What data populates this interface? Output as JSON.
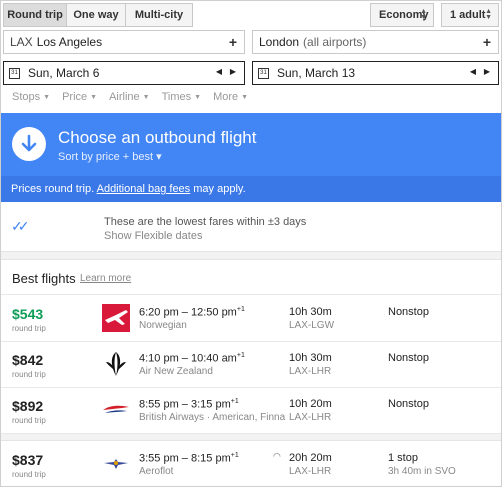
{
  "trip_types": [
    "Round trip",
    "One way",
    "Multi-city"
  ],
  "cabin": "Economy",
  "passengers": "1 adult",
  "origin": {
    "code": "LAX",
    "city": "Los Angeles"
  },
  "destination": {
    "city": "London",
    "detail": "(all airports)"
  },
  "depart_date": "Sun, March 6",
  "return_date": "Sun, March 13",
  "filters": [
    "Stops",
    "Price",
    "Airline",
    "Times",
    "More"
  ],
  "banner": {
    "title": "Choose an outbound flight",
    "sort": "Sort by price + best ▾"
  },
  "price_note": {
    "prefix": "Prices round trip.",
    "link": "Additional bag fees",
    "suffix": "may apply."
  },
  "lowest": {
    "text": "These are the lowest fares within ±3 days",
    "link": "Show Flexible dates"
  },
  "best": {
    "title": "Best flights",
    "learn_more": "Learn more"
  },
  "flights": [
    {
      "price": "$543",
      "price_sub": "round trip",
      "depart": "6:20 pm",
      "arrive": "12:50 pm",
      "plus": "+1",
      "airline": "Norwegian",
      "duration": "10h 30m",
      "route": "LAX-LGW",
      "stops": "Nonstop",
      "stops_detail": ""
    },
    {
      "price": "$842",
      "price_sub": "round trip",
      "depart": "4:10 pm",
      "arrive": "10:40 am",
      "plus": "+1",
      "airline": "Air New Zealand",
      "duration": "10h 30m",
      "route": "LAX-LHR",
      "stops": "Nonstop",
      "stops_detail": ""
    },
    {
      "price": "$892",
      "price_sub": "round trip",
      "depart": "8:55 pm",
      "arrive": "3:15 pm",
      "plus": "+1",
      "airline": "British Airways · American, Finna",
      "duration": "10h 20m",
      "route": "LAX-LHR",
      "stops": "Nonstop",
      "stops_detail": ""
    },
    {
      "price": "$837",
      "price_sub": "round trip",
      "depart": "3:55 pm",
      "arrive": "8:15 pm",
      "plus": "+1",
      "airline": "Aeroflot",
      "duration": "20h 20m",
      "route": "LAX-LHR",
      "stops": "1 stop",
      "stops_detail": "3h 40m in SVO"
    }
  ],
  "colors": {
    "accent": "#4285f4",
    "cheap": "#0d9d58",
    "norwegian": "#d81939",
    "ba": "#d4202a",
    "aeroflot": "#3a4a9b"
  }
}
